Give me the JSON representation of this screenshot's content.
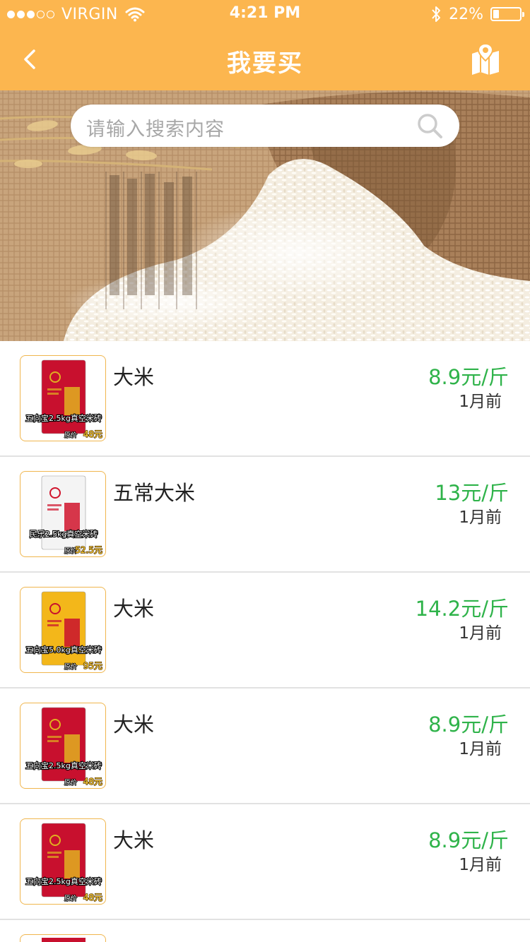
{
  "status_bar": {
    "carrier": "VIRGIN",
    "time": "4:21 PM",
    "battery": "22%",
    "battery_level": 0.22,
    "signal_bars": 3,
    "signal_total": 5
  },
  "nav": {
    "title": "我要买",
    "back_icon": "chevron-left-icon",
    "right_icon": "map-location-icon"
  },
  "search": {
    "placeholder": "请输入搜索内容",
    "icon": "search-icon"
  },
  "colors": {
    "header": "#fcb64f",
    "price": "#2fb34a",
    "thumb_border": "#f0b64e"
  },
  "products": [
    {
      "name": "大米",
      "price": "8.9元/斤",
      "time": "1月前",
      "bag_color": "red",
      "thumb_caption": "五向宝2.5kg真空米砖",
      "thumb_price_label": "原价",
      "thumb_price": "48元"
    },
    {
      "name": "五常大米",
      "price": "13元/斤",
      "time": "1月前",
      "bag_color": "white",
      "thumb_caption": "民乐2.5kg真空米砖",
      "thumb_price_label": "原价",
      "thumb_price": "52.5元"
    },
    {
      "name": "大米",
      "price": "14.2元/斤",
      "time": "1月前",
      "bag_color": "yellow",
      "thumb_caption": "五向宝5.0kg真空米砖",
      "thumb_price_label": "原价",
      "thumb_price": "95元"
    },
    {
      "name": "大米",
      "price": "8.9元/斤",
      "time": "1月前",
      "bag_color": "red",
      "thumb_caption": "五向宝2.5kg真空米砖",
      "thumb_price_label": "原价",
      "thumb_price": "48元"
    },
    {
      "name": "大米",
      "price": "8.9元/斤",
      "time": "1月前",
      "bag_color": "red",
      "thumb_caption": "五向宝2.5kg真空米砖",
      "thumb_price_label": "原价",
      "thumb_price": "48元"
    }
  ]
}
